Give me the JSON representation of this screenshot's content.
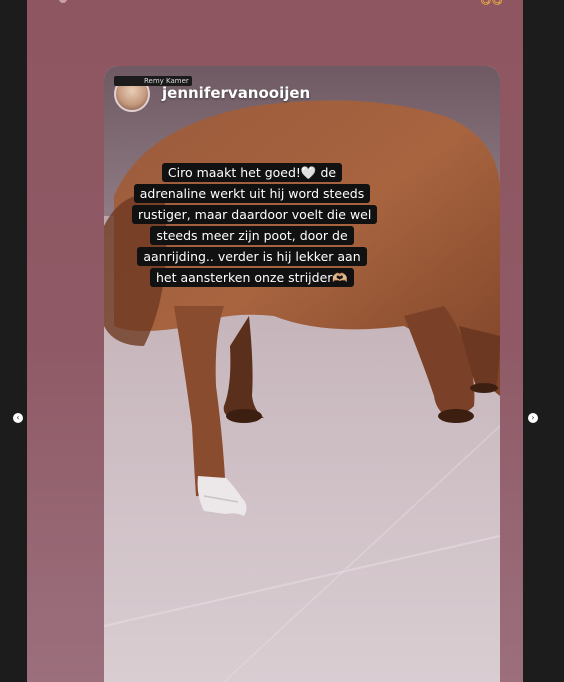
{
  "story": {
    "top_emojis": "😋😋",
    "reposted": {
      "avatar_tag": "Remy Kamer",
      "username": "jennifervanooijen",
      "caption": "Ciro maakt het goed!🤍 de adrenaline werkt uit hij word steeds rustiger, maar daardoor voelt die wel steeds meer zijn poot, door de aanrijding.. verder is hij lekker aan het aansterken onze strijder🫶🏼"
    }
  },
  "nav": {
    "prev_icon": "‹",
    "next_icon": "›"
  },
  "colors": {
    "story_background": "#8e5660",
    "caption_background": "#111111",
    "caption_text": "#ffffff"
  }
}
